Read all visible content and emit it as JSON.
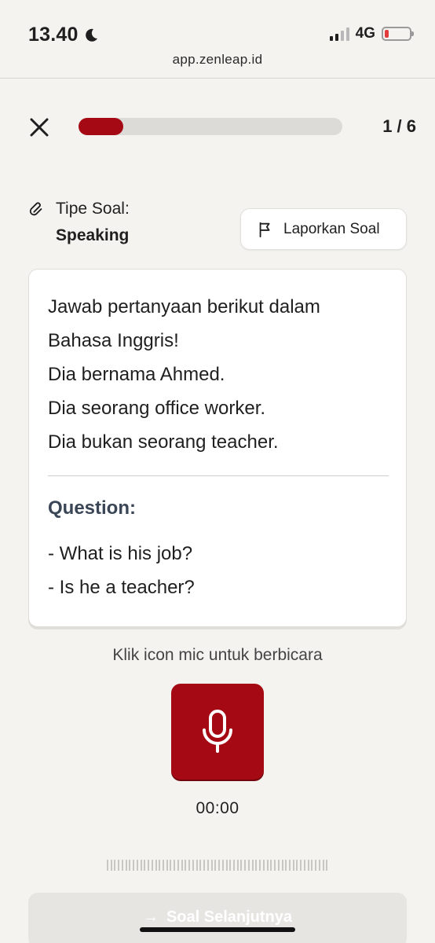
{
  "status_bar": {
    "time": "13.40",
    "network": "4G",
    "url": "app.zenleap.id"
  },
  "progress": {
    "current": 1,
    "total": 6,
    "label": "1 / 6",
    "fill_fraction": 0.17
  },
  "question_type": {
    "label": "Tipe Soal:",
    "value": "Speaking"
  },
  "report_button": {
    "label": "Laporkan Soal"
  },
  "card": {
    "lines": [
      "Jawab pertanyaan berikut dalam",
      "Bahasa Inggris!",
      "Dia bernama Ahmed.",
      "Dia seorang office worker.",
      "Dia bukan seorang teacher."
    ],
    "question_label": "Question:",
    "questions": [
      "- What is his job?",
      "- Is he a teacher?"
    ]
  },
  "mic": {
    "hint": "Klik icon mic untuk berbicara",
    "timer": "00:00"
  },
  "next_button": {
    "label": "Soal Selanjutnya"
  },
  "colors": {
    "accent": "#a50a14",
    "background": "#f4f3f0",
    "card": "#ffffff"
  },
  "icons": [
    "moon-icon",
    "signal-icon",
    "battery-icon",
    "close-icon",
    "paperclip-icon",
    "flag-icon",
    "microphone-icon",
    "arrow-right-icon"
  ]
}
